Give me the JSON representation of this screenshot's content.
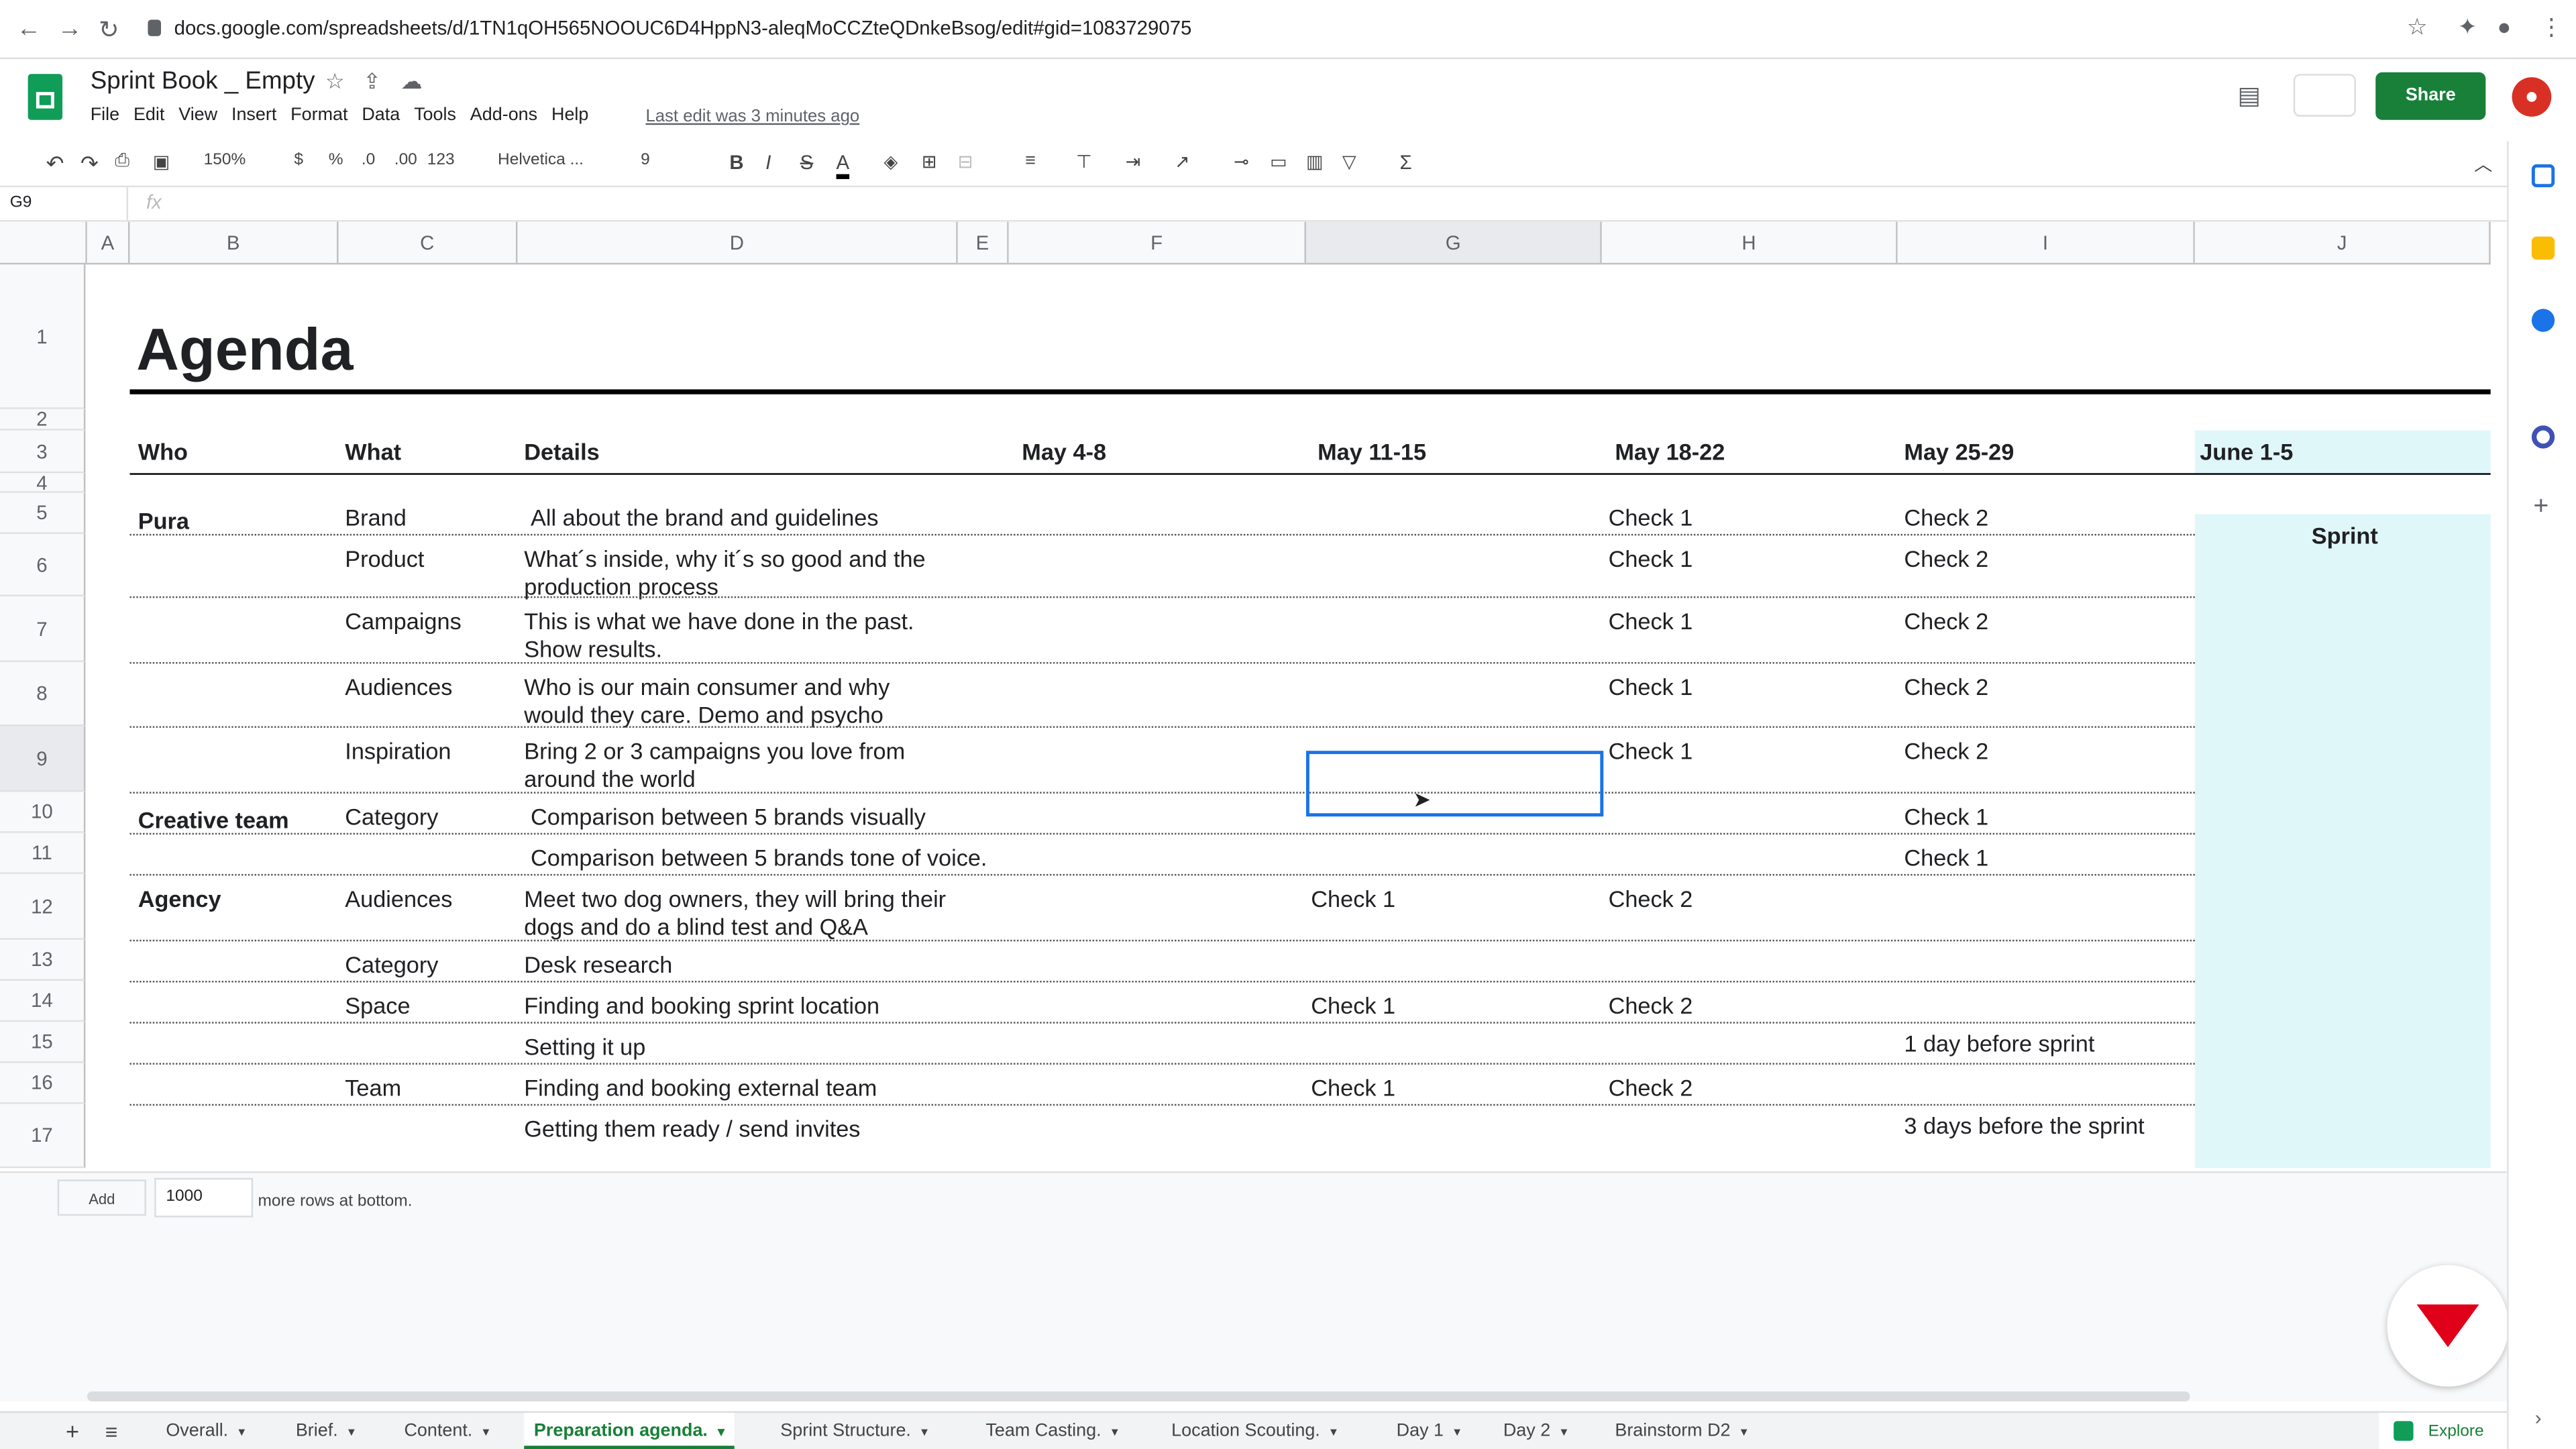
{
  "browser": {
    "url": "docs.google.com/spreadsheets/d/1TN1qOH565NOOUC6D4HppN3-aleqMoCCZteQDnkeBsog/edit#gid=1083729075"
  },
  "doc": {
    "title": "Sprint Book _ Empty",
    "last_edit": "Last edit was 3 minutes ago",
    "share_label": "Share"
  },
  "menu": [
    "File",
    "Edit",
    "View",
    "Insert",
    "Format",
    "Data",
    "Tools",
    "Add-ons",
    "Help"
  ],
  "toolbar": {
    "zoom": "150%",
    "currency": "$",
    "percent": "%",
    "dec_less": ".0",
    "dec_more": ".00",
    "format": "123",
    "font": "Helvetica ...",
    "size": "9",
    "bold": "B",
    "italic": "I",
    "strike": "S",
    "textcolor": "A",
    "sum": "Σ"
  },
  "formula_bar": {
    "cell_ref": "G9",
    "fx": "fx"
  },
  "columns": [
    "A",
    "B",
    "C",
    "D",
    "E",
    "F",
    "G",
    "H",
    "I",
    "J"
  ],
  "rows": [
    "1",
    "2",
    "3",
    "4",
    "5",
    "6",
    "7",
    "8",
    "9",
    "10",
    "11",
    "12",
    "13",
    "14",
    "15",
    "16",
    "17"
  ],
  "sheet": {
    "title": "Agenda",
    "headers": {
      "who": "Who",
      "what": "What",
      "details": "Details",
      "w1": "May 4-8",
      "w2": "May 11-15",
      "w3": "May 18-22",
      "w4": "May 25-29",
      "w5": "June 1-5"
    },
    "sprint": "Sprint",
    "cells": [
      {
        "r": 5,
        "who": "Pura",
        "what": "Brand",
        "d1": "All about the brand and guidelines",
        "d2": "",
        "g": "",
        "h": "Check 1",
        "i": "Check 2"
      },
      {
        "r": 6,
        "who": "",
        "what": "Product",
        "d1": "What´s inside, why it´s so good and the",
        "d2": "production process",
        "g": "",
        "h": "Check 1",
        "i": "Check 2"
      },
      {
        "r": 7,
        "who": "",
        "what": "Campaigns",
        "d1": "This is what we have done in the past.",
        "d2": "Show results.",
        "g": "",
        "h": "Check 1",
        "i": "Check 2"
      },
      {
        "r": 8,
        "who": "",
        "what": "Audiences",
        "d1": "Who is our main consumer and why",
        "d2": "would they care. Demo and psycho",
        "g": "",
        "h": "Check 1",
        "i": "Check 2"
      },
      {
        "r": 9,
        "who": "",
        "what": "Inspiration",
        "d1": "Bring 2 or 3 campaigns you love from",
        "d2": "around the world",
        "g": "",
        "h": "Check 1",
        "i": "Check 2"
      },
      {
        "r": 10,
        "who": "Creative team",
        "what": "Category",
        "d1": "Comparison between 5 brands visually",
        "d2": "",
        "g": "",
        "h": "",
        "i": "Check 1"
      },
      {
        "r": 11,
        "who": "",
        "what": "",
        "d1": "Comparison between 5 brands tone of voice.",
        "d2": "",
        "g": "",
        "h": "",
        "i": "Check 1"
      },
      {
        "r": 12,
        "who": "Agency",
        "what": "Audiences",
        "d1": "Meet two dog owners, they will bring their",
        "d2": "dogs and do a blind test and Q&A",
        "g": "Check 1",
        "h": "Check 2",
        "i": ""
      },
      {
        "r": 13,
        "who": "",
        "what": "Category",
        "d1": "Desk research",
        "d2": "",
        "g": "",
        "h": "",
        "i": ""
      },
      {
        "r": 14,
        "who": "",
        "what": "Space",
        "d1": "Finding and booking sprint location",
        "d2": "",
        "g": "Check 1",
        "h": "Check 2",
        "i": ""
      },
      {
        "r": 15,
        "who": "",
        "what": "",
        "d1": "Setting it up",
        "d2": "",
        "g": "",
        "h": "",
        "i": "1 day before sprint"
      },
      {
        "r": 16,
        "who": "",
        "what": "Team",
        "d1": "Finding and booking external team",
        "d2": "",
        "g": "Check 1",
        "h": "Check 2",
        "i": ""
      },
      {
        "r": 17,
        "who": "",
        "what": "",
        "d1": "Getting them ready / send invites",
        "d2": "",
        "g": "",
        "h": "",
        "i": "3 days before the sprint"
      }
    ]
  },
  "bottom": {
    "add_label": "Add",
    "rows_value": "1000",
    "more_text": "more rows at bottom."
  },
  "tabs": [
    "Overall.",
    "Brief.",
    "Content.",
    "Preparation agenda.",
    "Sprint Structure.",
    "Team Casting.",
    "Location Scouting.",
    "Day 1",
    "Day 2",
    "Brainstorm D2"
  ],
  "explore_label": "Explore",
  "colors": {
    "accent": "#188038",
    "sprint_bg": "#e0f7fa",
    "selection": "#1a73e8"
  }
}
